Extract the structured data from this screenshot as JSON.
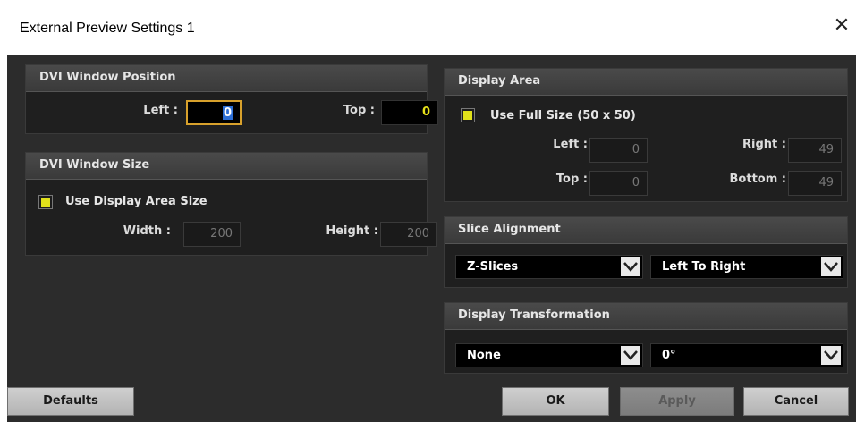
{
  "window": {
    "title": "External Preview Settings 1",
    "close_glyph": "✕"
  },
  "dvi_position": {
    "header": "DVI Window Position",
    "left_label": "Left :",
    "left_value": "0",
    "top_label": "Top :",
    "top_value": "0"
  },
  "dvi_size": {
    "header": "DVI Window Size",
    "use_display_area_label": "Use Display Area Size",
    "use_display_area_checked": true,
    "width_label": "Width :",
    "width_value": "200",
    "height_label": "Height :",
    "height_value": "200"
  },
  "display_area": {
    "header": "Display Area",
    "use_full_size_label": "Use Full Size (50 x 50)",
    "use_full_size_checked": true,
    "left_label": "Left :",
    "left_value": "0",
    "right_label": "Right :",
    "right_value": "49",
    "top_label": "Top :",
    "top_value": "0",
    "bottom_label": "Bottom :",
    "bottom_value": "49"
  },
  "slice_alignment": {
    "header": "Slice Alignment",
    "mode_value": "Z-Slices",
    "direction_value": "Left To Right"
  },
  "display_transformation": {
    "header": "Display Transformation",
    "transform_value": "None",
    "rotation_value": "0°"
  },
  "buttons": {
    "defaults": "Defaults",
    "ok": "OK",
    "apply": "Apply",
    "cancel": "Cancel"
  },
  "colors": {
    "accent_checkbox": "#e0e01b",
    "focus_border": "#d8a12c",
    "background": "#2c2c2c"
  }
}
